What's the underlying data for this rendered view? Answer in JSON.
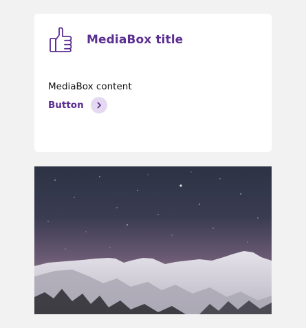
{
  "mediabox": {
    "title": "MediaBox title",
    "content": "MediaBox content",
    "button_label": "Button",
    "icon": "thumbs-up-icon",
    "button_icon": "chevron-right-icon"
  },
  "colors": {
    "accent": "#5b2e91",
    "button_icon_bg": "#e4d9f0",
    "page_bg": "#f2f2f2",
    "card_bg": "#ffffff"
  },
  "image": {
    "subject": "starry-night-sky-over-snowy-mountains"
  }
}
